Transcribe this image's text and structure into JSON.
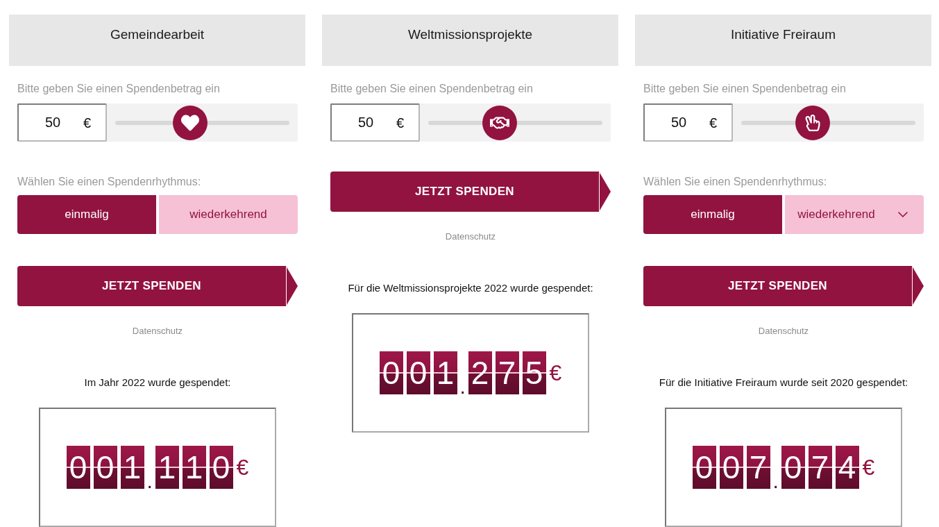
{
  "campaigns": [
    {
      "title": "Gemeindearbeit",
      "amount": {
        "label": "Bitte geben Sie einen Spendenbetrag ein",
        "value": "50",
        "currency": "€",
        "level": 0.43
      },
      "rhythm": {
        "label": "Wählen Sie einen Spendenrhythmus:",
        "options": [
          {
            "label": "einmalig",
            "selected": true
          },
          {
            "label": "wiederkehrend",
            "selected": false,
            "has_menu": false
          }
        ]
      },
      "donate_button": "JETZT SPENDEN",
      "privacy_link": "Datenschutz",
      "total": {
        "caption": "Im Jahr 2022 wurde gespendet:",
        "groups": [
          [
            "0",
            "0",
            "1"
          ],
          [
            "1",
            "1",
            "0"
          ]
        ],
        "separator": ".",
        "currency": "€"
      }
    },
    {
      "title": "Weltmissionsprojekte",
      "amount": {
        "label": "Bitte geben Sie einen Spendenbetrag ein",
        "value": "50",
        "currency": "€",
        "level": 0.41
      },
      "donate_button": "JETZT SPENDEN",
      "privacy_link": "Datenschutz",
      "total": {
        "caption": "Für die Weltmissionsprojekte 2022 wurde gespendet:",
        "groups": [
          [
            "0",
            "0",
            "1"
          ],
          [
            "2",
            "7",
            "5"
          ]
        ],
        "separator": ".",
        "currency": "€"
      }
    },
    {
      "title": "Initiative Freiraum",
      "amount": {
        "label": "Bitte geben Sie einen Spendenbetrag ein",
        "value": "50",
        "currency": "€",
        "level": 0.41
      },
      "rhythm": {
        "label": "Wählen Sie einen Spendenrhythmus:",
        "options": [
          {
            "label": "einmalig",
            "selected": true
          },
          {
            "label": "wiederkehrend",
            "selected": false,
            "has_menu": true
          }
        ]
      },
      "donate_button": "JETZT SPENDEN",
      "privacy_link": "Datenschutz",
      "total": {
        "caption": "Für die Initiative Freiraum wurde seit 2020 gespendet:",
        "groups": [
          [
            "0",
            "0",
            "7"
          ],
          [
            "0",
            "7",
            "4"
          ]
        ],
        "separator": ".",
        "currency": "€"
      }
    }
  ]
}
